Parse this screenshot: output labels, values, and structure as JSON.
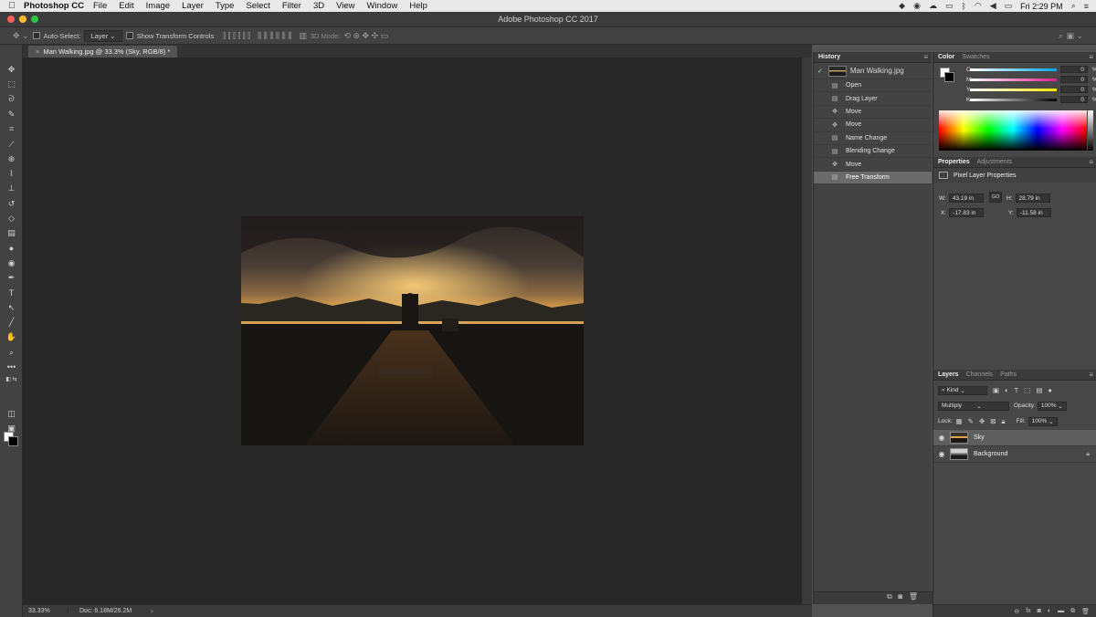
{
  "menubar": {
    "apple": "",
    "app_name": "Photoshop CC",
    "items": [
      "File",
      "Edit",
      "Image",
      "Layer",
      "Type",
      "Select",
      "Filter",
      "3D",
      "View",
      "Window",
      "Help"
    ],
    "clock": "Fri 2:29 PM"
  },
  "window": {
    "title": "Adobe Photoshop CC 2017"
  },
  "options": {
    "auto_select_label": "Auto-Select:",
    "auto_select_value": "Layer",
    "transform_label": "Show Transform Controls",
    "mode3d_label": "3D Mode:"
  },
  "document": {
    "tab_label": "Man Walking.jpg @ 33.3% (Sky, RGB/8) *",
    "close": "×"
  },
  "status": {
    "zoom": "33.33%",
    "doc": "Doc: 6.18M/26.2M",
    "arrow": "›"
  },
  "history": {
    "tab": "History",
    "snapshot": "Man Walking.jpg",
    "items": [
      {
        "label": "Open",
        "icon": "doc-icon",
        "glyph": "▤"
      },
      {
        "label": "Drag Layer",
        "icon": "doc-icon",
        "glyph": "▤"
      },
      {
        "label": "Move",
        "icon": "move-icon",
        "glyph": "✥"
      },
      {
        "label": "Move",
        "icon": "move-icon",
        "glyph": "✥"
      },
      {
        "label": "Name Change",
        "icon": "doc-icon",
        "glyph": "▤"
      },
      {
        "label": "Blending Change",
        "icon": "doc-icon",
        "glyph": "▤"
      },
      {
        "label": "Move",
        "icon": "move-icon",
        "glyph": "✥"
      },
      {
        "label": "Free Transform",
        "icon": "doc-icon",
        "glyph": "▤"
      }
    ],
    "selected_index": 7
  },
  "color": {
    "tabs": [
      "Color",
      "Swatches"
    ],
    "channels": [
      {
        "label": "C",
        "value": "0",
        "unit": "%"
      },
      {
        "label": "M",
        "value": "0",
        "unit": "%"
      },
      {
        "label": "Y",
        "value": "0",
        "unit": "%"
      },
      {
        "label": "K",
        "value": "0",
        "unit": "%"
      }
    ]
  },
  "properties": {
    "tabs": [
      "Properties",
      "Adjustments"
    ],
    "title": "Pixel Layer Properties",
    "w_label": "W:",
    "w_value": "43.19 in",
    "h_label": "H:",
    "h_value": "28.79 in",
    "x_label": "X:",
    "x_value": "-17.83 in",
    "y_label": "Y:",
    "y_value": "-11.58 in",
    "link": "GO"
  },
  "layers": {
    "tabs": [
      "Layers",
      "Channels",
      "Paths"
    ],
    "filter": "Kind",
    "blend_mode": "Multiply",
    "opacity_label": "Opacity:",
    "opacity_value": "100%",
    "lock_label": "Lock:",
    "fill_label": "Fill:",
    "fill_value": "100%",
    "items": [
      {
        "name": "Sky",
        "selected": true,
        "locked": false
      },
      {
        "name": "Background",
        "selected": false,
        "locked": true
      }
    ]
  },
  "colors": {
    "accent_selected": "#6a6a6a",
    "panel_bg": "#474747",
    "canvas_bg": "#282828"
  }
}
